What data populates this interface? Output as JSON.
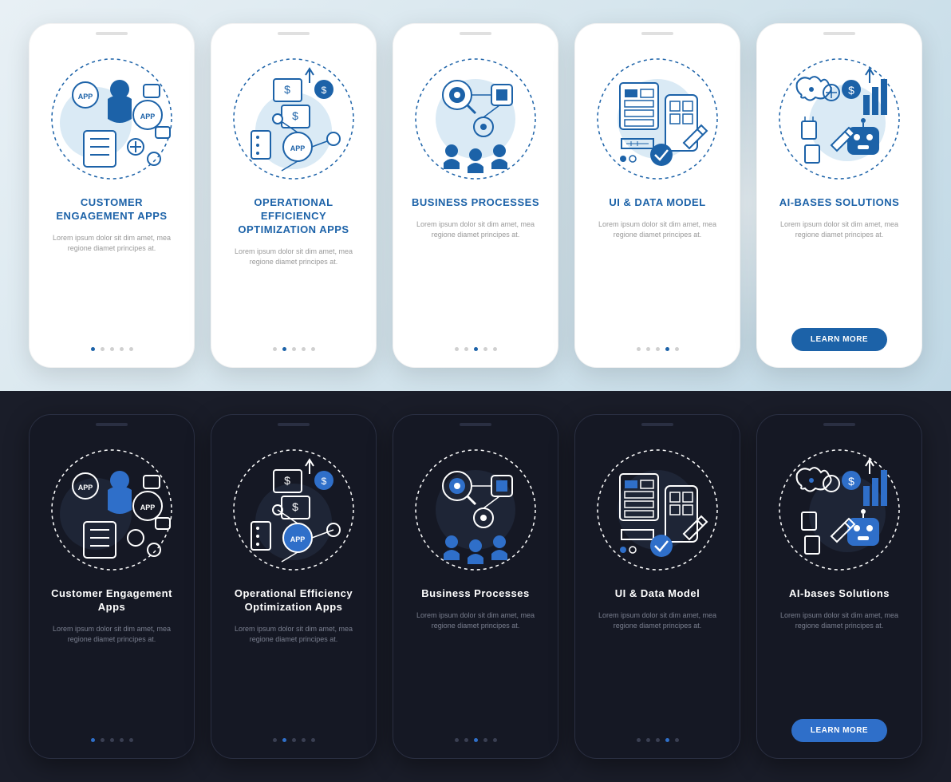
{
  "lorem": "Lorem ipsum dolor sit dim amet, mea regione diamet principes at.",
  "cta": "LEARN MORE",
  "light": {
    "cards": [
      {
        "title": "CUSTOMER ENGAGEMENT APPS",
        "active": 0
      },
      {
        "title": "OPERATIONAL EFFICIENCY OPTIMIZATION APPS",
        "active": 1
      },
      {
        "title": "BUSINESS PROCESSES",
        "active": 2
      },
      {
        "title": "UI & DATA MODEL",
        "active": 3
      },
      {
        "title": "AI-BASES SOLUTIONS",
        "active": 4
      }
    ]
  },
  "dark": {
    "cards": [
      {
        "title": "Customer Engagement Apps",
        "active": 0
      },
      {
        "title": "Operational Efficiency Optimization Apps",
        "active": 1
      },
      {
        "title": "Business Processes",
        "active": 2
      },
      {
        "title": "UI & Data Model",
        "active": 3
      },
      {
        "title": "AI-bases Solutions",
        "active": 4
      }
    ]
  }
}
